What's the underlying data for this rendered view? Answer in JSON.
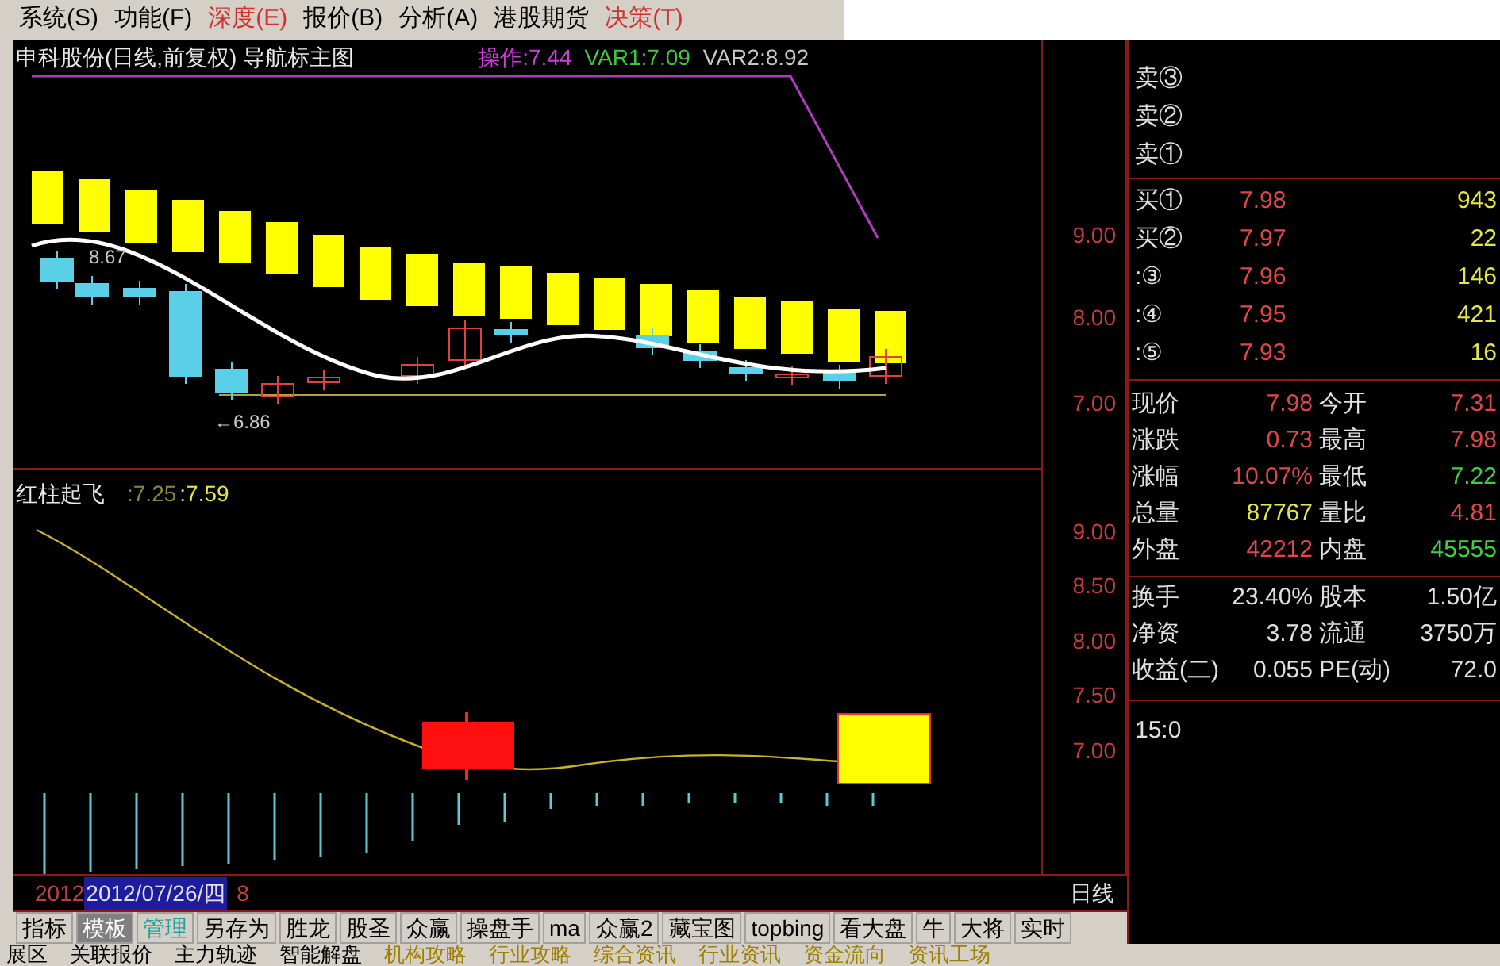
{
  "menu": [
    {
      "label": "系统(S)",
      "accent": false
    },
    {
      "label": "功能(F)",
      "accent": false
    },
    {
      "label": "深度(E)",
      "accent": true
    },
    {
      "label": "报价(B)",
      "accent": false
    },
    {
      "label": "分析(A)",
      "accent": false
    },
    {
      "label": "港股期货",
      "accent": false
    },
    {
      "label": "决策(T)",
      "accent": true
    }
  ],
  "main_chart": {
    "title": "申科股份(日线,前复权) 导航标主图",
    "indicators": [
      {
        "text": "操作:7.44",
        "kind": "operation"
      },
      {
        "text": "VAR1:7.09",
        "kind": "var1"
      },
      {
        "text": "VAR2:8.92",
        "kind": "var2"
      }
    ],
    "annotations": [
      "8.67",
      "←6.86"
    ],
    "axis_ticks": [
      "9.00",
      "8.00",
      "7.00"
    ]
  },
  "sub_chart": {
    "title": "红柱起飞",
    "indicators": [
      {
        "text": ":7.25",
        "color": "#8a8a3c"
      },
      {
        "text": ":7.59",
        "color": "#e6e646"
      }
    ],
    "axis_ticks": [
      "9.00",
      "8.50",
      "8.00",
      "7.50",
      "7.00"
    ]
  },
  "order_book": {
    "sell": [
      {
        "label": "卖③"
      },
      {
        "label": "卖②"
      },
      {
        "label": "卖①"
      }
    ],
    "buy": [
      {
        "label": "买①",
        "price": "7.98",
        "volume": "943"
      },
      {
        "label": "买②",
        "price": "7.97",
        "volume": "22"
      },
      {
        "label": ":③",
        "price": "7.96",
        "volume": "146"
      },
      {
        "label": ":④",
        "price": "7.95",
        "volume": "421"
      },
      {
        "label": ":⑤",
        "price": "7.93",
        "volume": "16"
      }
    ]
  },
  "quote": [
    {
      "left": {
        "label": "现价",
        "value": "7.98",
        "color": "#e04848"
      },
      "right": {
        "label": "今开",
        "value": "7.31",
        "color": "#e04848"
      }
    },
    {
      "left": {
        "label": "涨跌",
        "value": "0.73",
        "color": "#e04848"
      },
      "right": {
        "label": "最高",
        "value": "7.98",
        "color": "#e04848"
      }
    },
    {
      "left": {
        "label": "涨幅",
        "value": "10.07%",
        "color": "#e04848"
      },
      "right": {
        "label": "最低",
        "value": "7.22",
        "color": "#40d040"
      }
    },
    {
      "left": {
        "label": "总量",
        "value": "87767",
        "color": "#e6e646"
      },
      "right": {
        "label": "量比",
        "value": "4.81",
        "color": "#e04848"
      }
    },
    {
      "left": {
        "label": "外盘",
        "value": "42212",
        "color": "#e04848"
      },
      "right": {
        "label": "内盘",
        "value": "45555",
        "color": "#40d040"
      }
    }
  ],
  "fundamentals": [
    {
      "label": "换手",
      "value": "23.40%",
      "label2": "股本",
      "value2": "1.50亿"
    },
    {
      "label": "净资",
      "value": "3.78",
      "label2": "流通",
      "value2": "3750万"
    },
    {
      "label": "收益(二)",
      "value": "0.055",
      "label2": "PE(动)",
      "value2": "72.0"
    }
  ],
  "time": "15:0",
  "date_bar": {
    "prefix": "2012",
    "date": "2012/07/26/四",
    "suffix": "8",
    "period": "日线"
  },
  "tabs": [
    {
      "label": "指标",
      "selected": false,
      "highlighted": false
    },
    {
      "label": "模板",
      "selected": true,
      "highlighted": false
    },
    {
      "label": "管理",
      "selected": false,
      "highlighted": true
    },
    {
      "label": "另存为",
      "selected": false,
      "highlighted": false
    },
    {
      "label": "胜龙",
      "selected": false,
      "highlighted": false
    },
    {
      "label": "股圣",
      "selected": false,
      "highlighted": false
    },
    {
      "label": "众赢",
      "selected": false,
      "highlighted": false
    },
    {
      "label": "操盘手",
      "selected": false,
      "highlighted": false
    },
    {
      "label": "ma",
      "selected": false,
      "highlighted": false
    },
    {
      "label": "众赢2",
      "selected": false,
      "highlighted": false
    },
    {
      "label": "藏宝图",
      "selected": false,
      "highlighted": false
    },
    {
      "label": "topbing",
      "selected": false,
      "highlighted": false
    },
    {
      "label": "看大盘",
      "selected": false,
      "highlighted": false
    },
    {
      "label": "牛",
      "selected": false,
      "highlighted": false
    },
    {
      "label": "大将",
      "selected": false,
      "highlighted": false
    },
    {
      "label": "实时",
      "selected": false,
      "highlighted": false
    }
  ],
  "bottom_links": [
    {
      "label": "展区",
      "highlighted": false
    },
    {
      "label": "关联报价",
      "highlighted": false
    },
    {
      "label": "主力轨迹",
      "highlighted": false
    },
    {
      "label": "智能解盘",
      "highlighted": false
    },
    {
      "label": "机构攻略",
      "highlighted": true
    },
    {
      "label": "行业攻略",
      "highlighted": true
    },
    {
      "label": "综合资讯",
      "highlighted": true
    },
    {
      "label": "行业资讯",
      "highlighted": true
    },
    {
      "label": "资金流向",
      "highlighted": true
    },
    {
      "label": "资讯工场",
      "highlighted": true
    }
  ]
}
